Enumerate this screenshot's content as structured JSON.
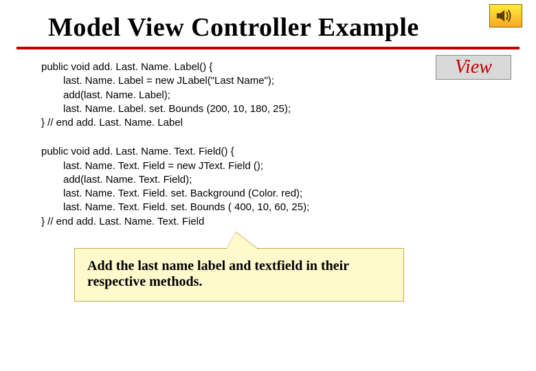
{
  "title": "Model View Controller Example",
  "badge": "View",
  "icons": {
    "sound": "sound-icon"
  },
  "code1": {
    "l0": "public void add. Last. Name. Label() {",
    "l1": "last. Name. Label = new JLabel(\"Last Name\");",
    "l2": "add(last. Name. Label);",
    "l3": "last. Name. Label. set. Bounds (200, 10, 180, 25);",
    "l4": "} // end add. Last. Name. Label"
  },
  "code2": {
    "l0": "public void add. Last. Name. Text. Field() {",
    "l1": "last. Name. Text. Field = new JText. Field ();",
    "l2": "add(last. Name. Text. Field);",
    "l3": "last. Name. Text. Field. set. Background (Color. red);",
    "l4": "last. Name. Text. Field. set. Bounds ( 400, 10, 60, 25);",
    "l5": "} // end add. Last. Name. Text. Field"
  },
  "callout": "Add the last name label and textfield in their respective methods."
}
